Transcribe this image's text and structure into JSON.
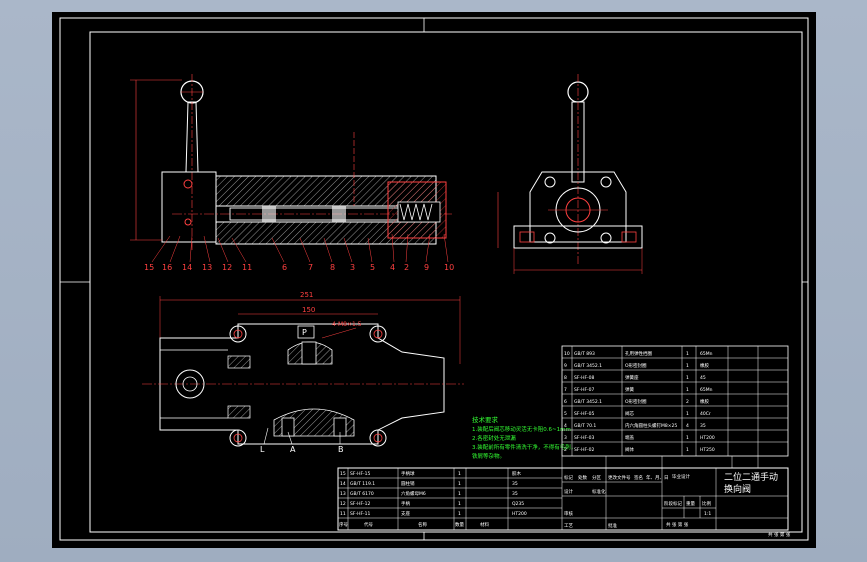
{
  "drawing": {
    "title_line1": "二位二通手动",
    "title_line2": "换向阀",
    "scale": "1:1"
  },
  "tech_requirements": {
    "heading": "技术要求",
    "lines": [
      "1.装配后阀芯移动灵活无卡阻0.6~1mm",
      "2.各密封处无泄漏",
      "3.装配前所有零件清洗干净，不得有毛刺，",
      "     铁屑等杂物。"
    ]
  },
  "port_labels": {
    "p": "P",
    "a": "A",
    "b": "B",
    "l": "L"
  },
  "dimensions": {
    "overall_length": "251",
    "hole_pitch": "150",
    "thread": "4-M8×1.5"
  },
  "section_view": {
    "top_numbers": [
      "15",
      "16",
      "14",
      "13",
      "12",
      "11",
      "6",
      "7",
      "8",
      "3",
      "5",
      "4",
      "2",
      "9",
      "10"
    ]
  },
  "parts_list_side": {
    "rows": [
      {
        "no": "10",
        "code": "GB/T 893",
        "name": "孔用弹性挡圈",
        "qty": "1",
        "mat": "65Mn"
      },
      {
        "no": "9",
        "code": "GB/T 3452.1",
        "name": "O形密封圈",
        "qty": "1",
        "mat": "橡胶"
      },
      {
        "no": "8",
        "code": "SF-HF-08",
        "name": "弹簧座",
        "qty": "1",
        "mat": "45"
      },
      {
        "no": "7",
        "code": "SF-HF-07",
        "name": "弹簧",
        "qty": "1",
        "mat": "65Mn"
      },
      {
        "no": "6",
        "code": "GB/T 3452.1",
        "name": "O形密封圈",
        "qty": "2",
        "mat": "橡胶"
      },
      {
        "no": "5",
        "code": "SF-HF-05",
        "name": "阀芯",
        "qty": "1",
        "mat": "40Cr"
      },
      {
        "no": "4",
        "code": "GB/T 70.1",
        "name": "内六角圆柱头螺钉M8×25",
        "qty": "4",
        "mat": "35"
      },
      {
        "no": "3",
        "code": "SF-HF-03",
        "name": "端盖",
        "qty": "1",
        "mat": "HT200"
      },
      {
        "no": "2",
        "code": "SF-HF-02",
        "name": "阀体",
        "qty": "1",
        "mat": "HT250"
      }
    ]
  },
  "parts_list_bottom": {
    "rows": [
      {
        "no": "15",
        "code": "SF-HF-15",
        "name": "手柄球",
        "qty": "1",
        "mat": "胶木"
      },
      {
        "no": "14",
        "code": "GB/T 119.1",
        "name": "圆柱销",
        "qty": "1",
        "mat": "35"
      },
      {
        "no": "13",
        "code": "GB/T 6170",
        "name": "六角螺母M6",
        "qty": "1",
        "mat": "35"
      },
      {
        "no": "12",
        "code": "SF-HF-12",
        "name": "手柄",
        "qty": "1",
        "mat": "Q235"
      },
      {
        "no": "11",
        "code": "SF-HF-11",
        "name": "支座",
        "qty": "1",
        "mat": "HT200"
      }
    ],
    "header": [
      "序号",
      "代号",
      "名称",
      "数量",
      "材料"
    ]
  },
  "title_block_labels": {
    "design": "设计",
    "standard": "标准化",
    "check": "审核",
    "craft": "工艺",
    "approve": "批准",
    "stage": "阶段标记",
    "weight": "重量",
    "ratio": "比例",
    "sheets": "共 张 第 张",
    "mark": "标记",
    "count": "处数",
    "zone": "分区",
    "doc": "更改文件号",
    "sign": "签名",
    "date": "年、月、日",
    "school": "毕业设计"
  },
  "corner_note": "共 张 第 张"
}
